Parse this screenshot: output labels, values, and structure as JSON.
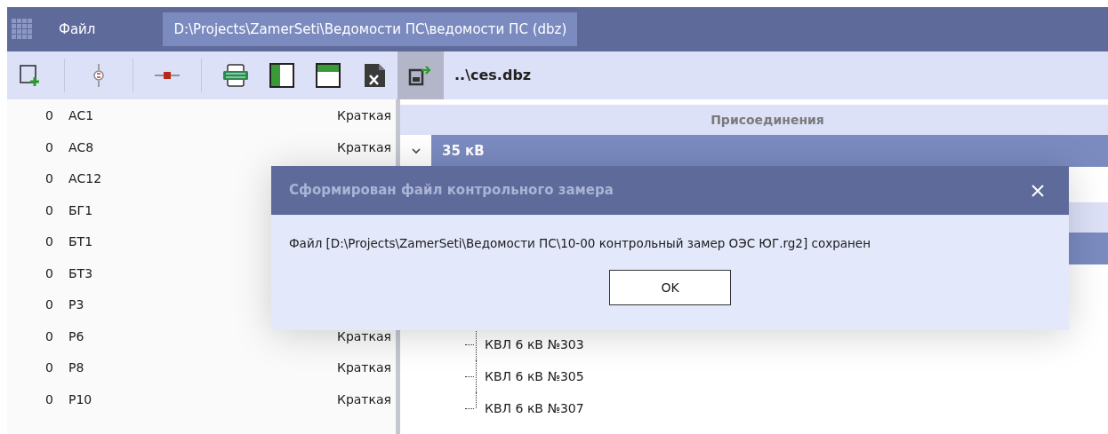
{
  "title_bar": {
    "menu": "Файл",
    "document_tab": "D:\\Projects\\ZamerSeti\\Ведомости ПС\\ведомости ПС (dbz)"
  },
  "toolbar": {
    "tools": [
      {
        "kind": "new",
        "pressed": false
      },
      {
        "kind": "separator"
      },
      {
        "kind": "meter",
        "pressed": false
      },
      {
        "kind": "separator"
      },
      {
        "kind": "resistor",
        "pressed": false
      },
      {
        "kind": "separator"
      },
      {
        "kind": "xlsx",
        "pressed": false
      },
      {
        "kind": "split-left",
        "pressed": false
      },
      {
        "kind": "split-top",
        "pressed": false
      },
      {
        "kind": "excel",
        "pressed": false
      },
      {
        "kind": "export",
        "pressed": true
      }
    ],
    "file": "..\\ces.dbz"
  },
  "objects": [
    {
      "count": "0",
      "name": "АС1",
      "mode": "Краткая"
    },
    {
      "count": "0",
      "name": "АС8",
      "mode": "Краткая"
    },
    {
      "count": "0",
      "name": "АС12"
    },
    {
      "count": "0",
      "name": "БГ1"
    },
    {
      "count": "0",
      "name": "БТ1"
    },
    {
      "count": "0",
      "name": "БТ3"
    },
    {
      "count": "0",
      "name": "Р3"
    },
    {
      "count": "0",
      "name": "Р6",
      "mode": "Краткая"
    },
    {
      "count": "0",
      "name": "Р8",
      "mode": "Краткая"
    },
    {
      "count": "0",
      "name": "Р10",
      "mode": "Краткая"
    }
  ],
  "connections": {
    "header": "Присоединения",
    "group": {
      "label": "35 кВ",
      "expanded": true
    },
    "items": [
      "КВЛ 6 кВ №303",
      "КВЛ 6 кВ №305",
      "КВЛ 6 кВ №307"
    ]
  },
  "dialog": {
    "title": "Сформирован файл контрольного замера",
    "message": "Файл [D:\\Projects\\ZamerSeti\\Ведомости ПС\\10-00 контрольный замер ОЭС ЮГ.rg2] сохранен",
    "button": "OK"
  }
}
